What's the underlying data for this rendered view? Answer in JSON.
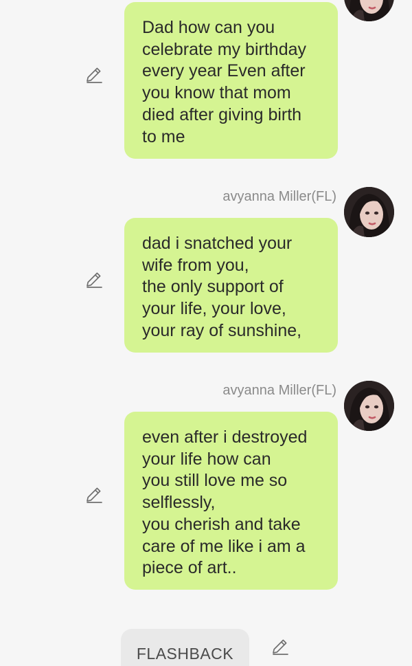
{
  "chat": {
    "messages": [
      {
        "sender": "",
        "text": "Dad how can you\ncelebrate my birthday\nevery year Even after\nyou know that mom\ndied after giving birth\nto me"
      },
      {
        "sender": "avyanna Miller(FL)",
        "text": "dad i snatched your\nwife from you,\nthe only support of\nyour life, your love,\nyour ray of sunshine,"
      },
      {
        "sender": "avyanna Miller(FL)",
        "text": "even after i destroyed\nyour life how can\nyou still love me so\nselflessly,\nyou cherish and take\ncare of me like i am a\npiece of art.."
      }
    ],
    "flashback_label": "FLASHBACK"
  },
  "icons": {
    "edit": "pencil-edit-icon",
    "avatar": "character-avatar"
  },
  "colors": {
    "background": "#f6f6f6",
    "bubble": "#d5f492",
    "sender_name": "#8a8a8a",
    "chip": "#e9e9e9"
  }
}
